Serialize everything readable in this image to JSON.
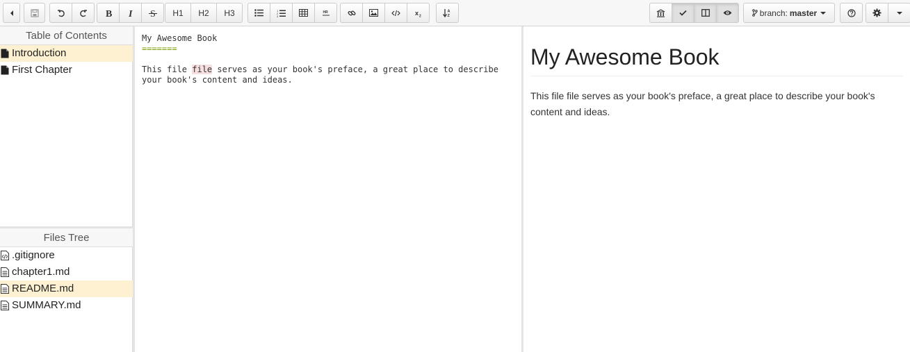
{
  "toolbar": {
    "h1_label": "H1",
    "h2_label": "H2",
    "h3_label": "H3",
    "branch_prefix": "branch:",
    "branch_name": "master"
  },
  "toc": {
    "title": "Table of Contents",
    "items": [
      {
        "label": "Introduction",
        "selected": true
      },
      {
        "label": "First Chapter",
        "selected": false
      }
    ]
  },
  "files": {
    "title": "Files Tree",
    "items": [
      {
        "label": ".gitignore",
        "icon": "code-file-icon"
      },
      {
        "label": "chapter1.md",
        "icon": "text-file-icon"
      },
      {
        "label": "README.md",
        "icon": "text-file-icon",
        "selected": true
      },
      {
        "label": "SUMMARY.md",
        "icon": "text-file-icon"
      }
    ]
  },
  "editor": {
    "line1": "My Awesome Book",
    "line2": "=======",
    "line4_pre": "This file ",
    "line4_hl": "file",
    "line4_post": " serves as your book's preface, a great place to describe",
    "line5": "your book's content and ideas."
  },
  "preview": {
    "heading": "My Awesome Book",
    "paragraph": "This file file serves as your book's preface, a great place to describe your book's content and ideas."
  }
}
